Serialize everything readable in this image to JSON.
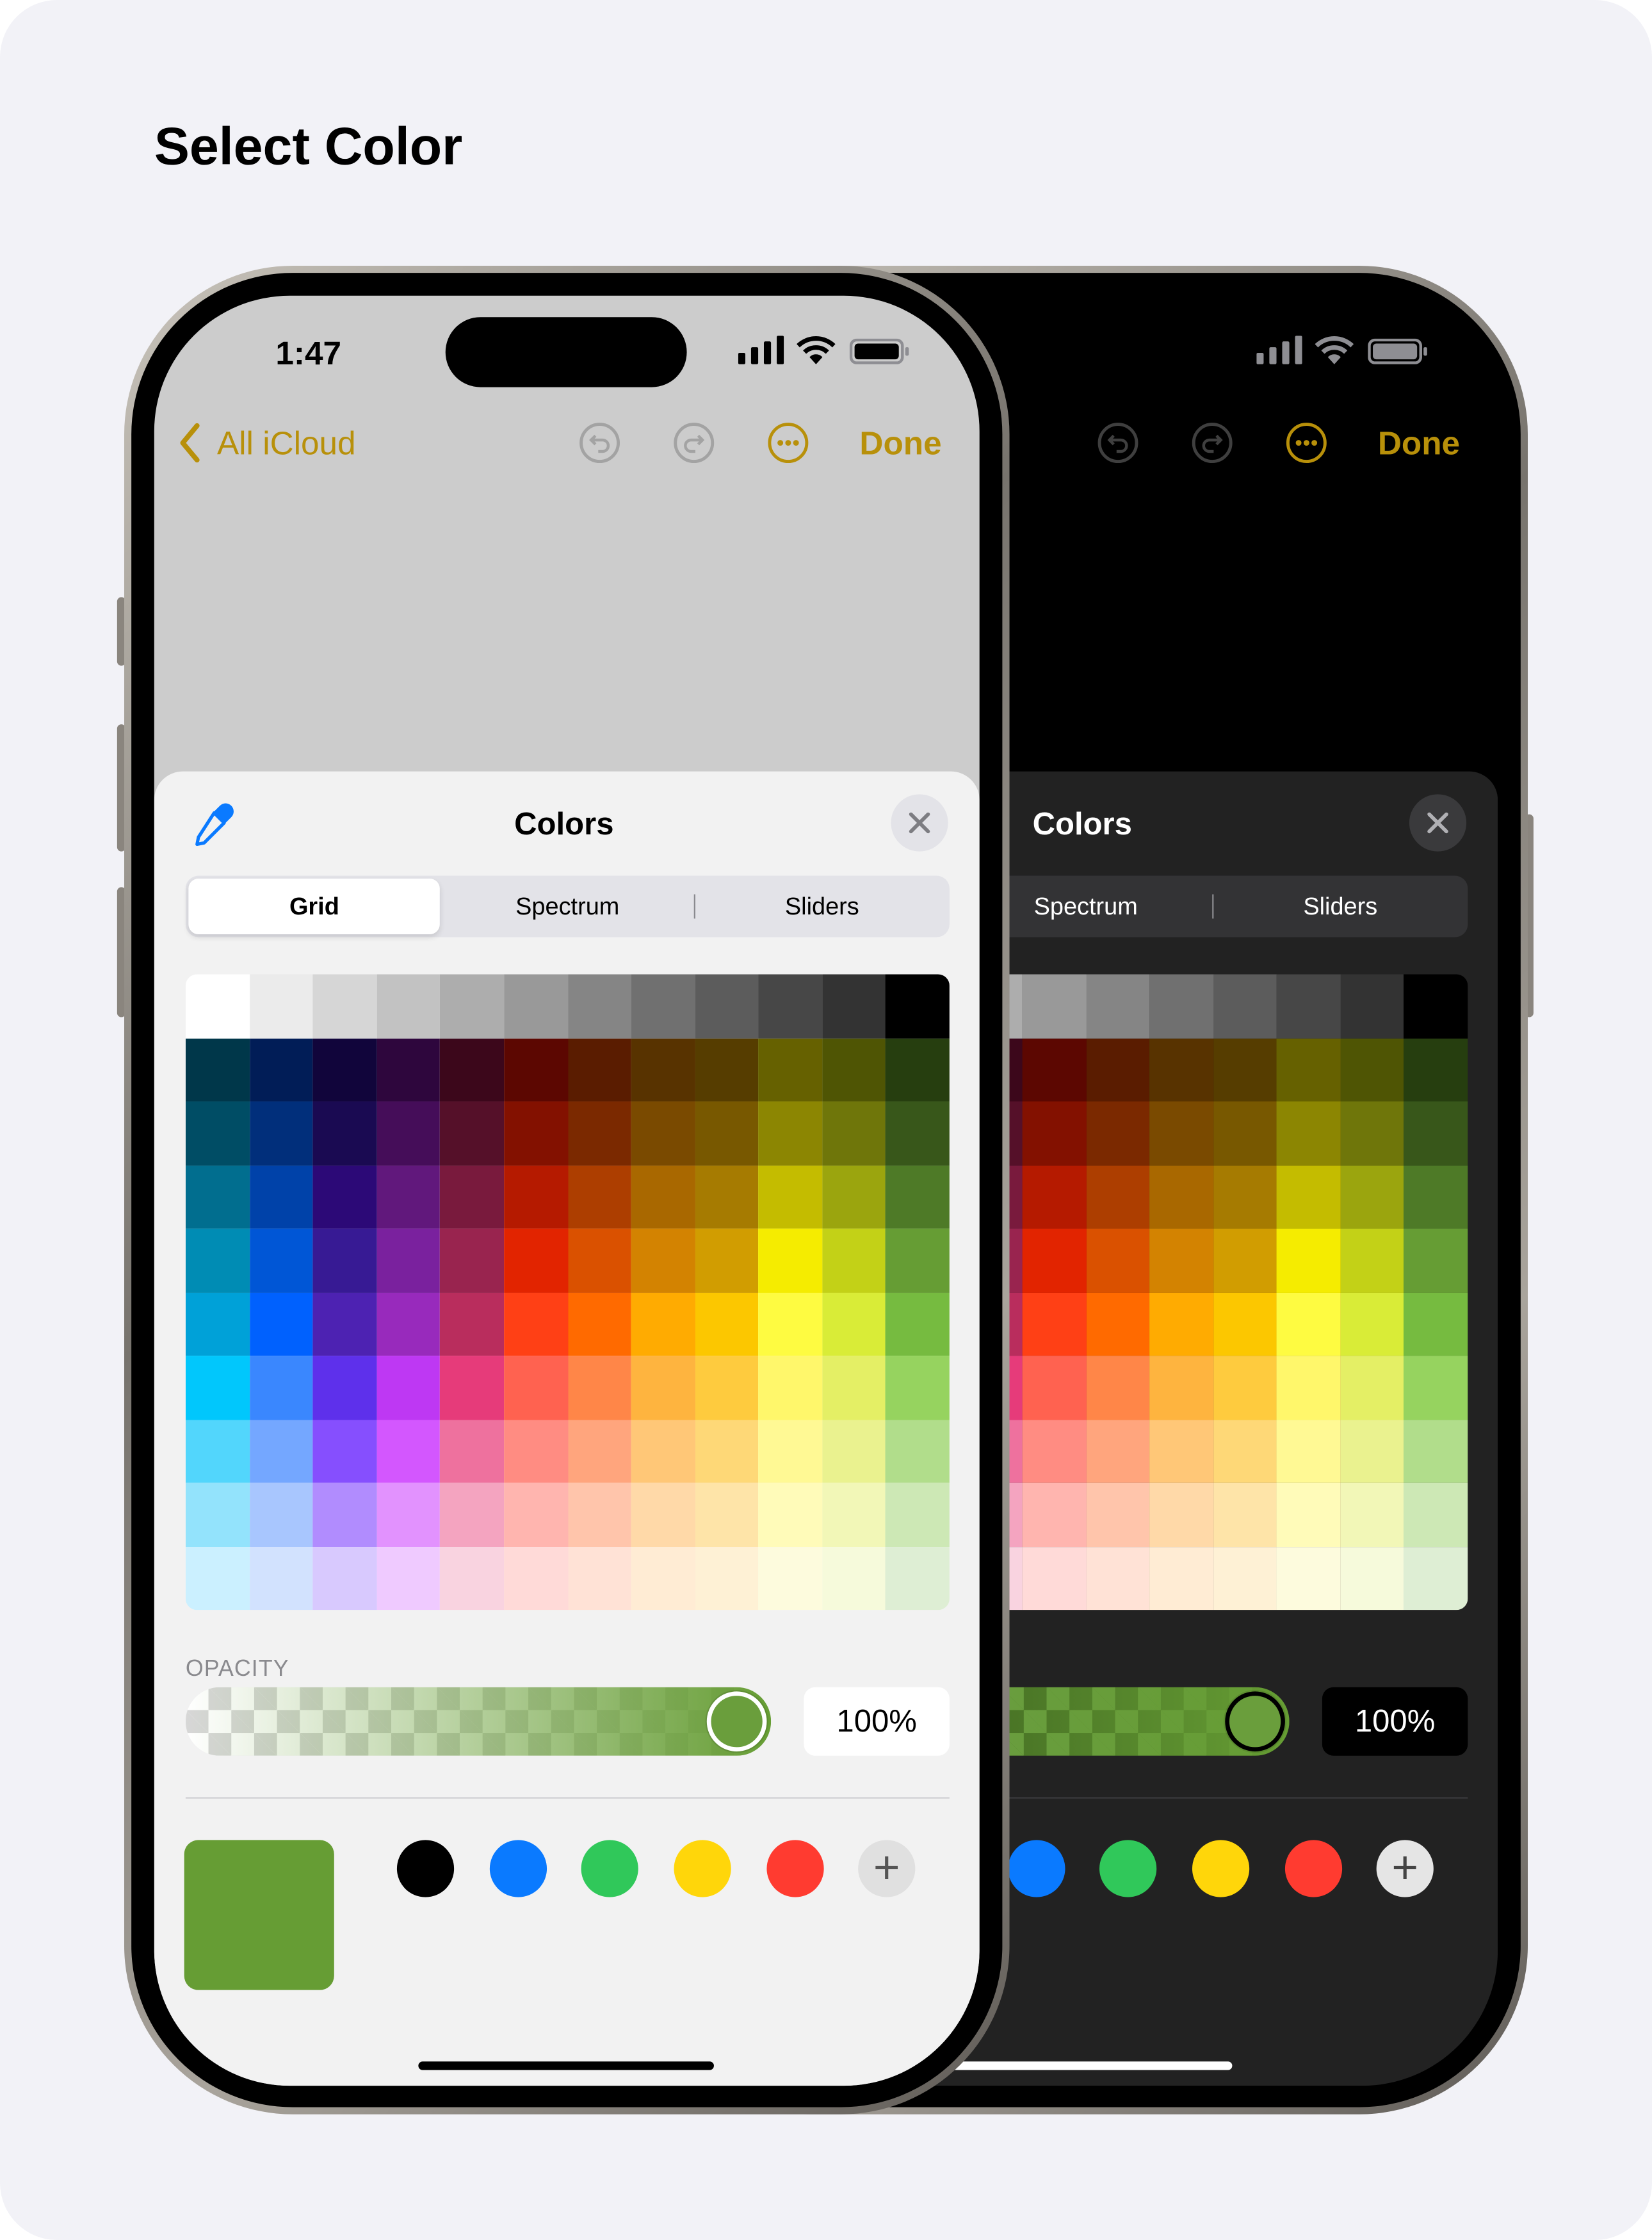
{
  "page_title": "Select Color",
  "status": {
    "time": "1:47"
  },
  "nav": {
    "back_label": "All iCloud",
    "done_label": "Done",
    "icons": [
      "undo-icon",
      "redo-icon",
      "more-icon"
    ]
  },
  "sheet": {
    "title": "Colors",
    "tabs": [
      {
        "label": "Grid",
        "selected": true
      },
      {
        "label": "Spectrum",
        "selected": false
      },
      {
        "label": "Sliders",
        "selected": false
      }
    ],
    "opacity_label": "OPACITY",
    "opacity_value": "100%",
    "opacity_percent": 100,
    "selected_color": "#669d34",
    "presets": [
      "#000000",
      "#0a7aff",
      "#30c85a",
      "#ffd60a",
      "#ff3b30"
    ],
    "add_label": "+"
  },
  "accent": "#b8900a",
  "grid": [
    [
      "#ffffff",
      "#ebebeb",
      "#d6d6d6",
      "#c2c2c2",
      "#adadad",
      "#999999",
      "#858585",
      "#707070",
      "#5c5c5c",
      "#474747",
      "#333333",
      "#000000"
    ],
    [
      "#00374a",
      "#011d57",
      "#11053b",
      "#2e063d",
      "#3c071b",
      "#5c0701",
      "#5a1c00",
      "#583300",
      "#563d00",
      "#666100",
      "#4f5504",
      "#263e0f"
    ],
    [
      "#004d65",
      "#012f7b",
      "#1a0a52",
      "#450d59",
      "#551029",
      "#831100",
      "#7b2900",
      "#7a4a00",
      "#785800",
      "#8c8602",
      "#6f760a",
      "#38571a"
    ],
    [
      "#016e8f",
      "#0042a9",
      "#2c0977",
      "#61187c",
      "#791a3d",
      "#b51a00",
      "#ad3e00",
      "#a96800",
      "#a67b01",
      "#c4bc00",
      "#9ba50e",
      "#4e7a27"
    ],
    [
      "#008cb4",
      "#0056d6",
      "#371a94",
      "#7a219e",
      "#99244f",
      "#e22400",
      "#da5100",
      "#d38301",
      "#d19d01",
      "#f5ec00",
      "#c3d117",
      "#669d34"
    ],
    [
      "#00a1d8",
      "#0061fe",
      "#4d22b2",
      "#982abc",
      "#b92d5d",
      "#ff4015",
      "#ff6a00",
      "#ffab01",
      "#fcc700",
      "#fefb41",
      "#d9ec37",
      "#76bb40"
    ],
    [
      "#01c7fc",
      "#3a87fe",
      "#5e30eb",
      "#be38f3",
      "#e63b7a",
      "#ff6250",
      "#ff8648",
      "#feb43f",
      "#fecb3e",
      "#fff76b",
      "#e4ef65",
      "#96d35f"
    ],
    [
      "#52d6fc",
      "#74a7ff",
      "#864ffe",
      "#d357fe",
      "#ee719e",
      "#ff8c82",
      "#ffa57d",
      "#ffc777",
      "#fed877",
      "#fff994",
      "#eaf28f",
      "#b1dd8b"
    ],
    [
      "#93e3fc",
      "#a8c6fe",
      "#b18cfe",
      "#e292fe",
      "#f4a4c0",
      "#ffb5af",
      "#ffc5ab",
      "#ffd9a8",
      "#fee4a8",
      "#fffbb9",
      "#f2f7b7",
      "#cde8b5"
    ],
    [
      "#cbf0ff",
      "#d2e2fe",
      "#d8c9fe",
      "#efcaff",
      "#f9d3e0",
      "#ffdad8",
      "#ffe2d6",
      "#ffecd4",
      "#fef1d5",
      "#fdfbdd",
      "#f6fadb",
      "#deeed4"
    ]
  ],
  "themes": {
    "light": {
      "top_bg": "#cccccc",
      "sheet_bg": "#f2f2f2",
      "text": "#000000",
      "seg_bg": "#e3e3e8",
      "seg_sel": "#ffffff",
      "field_bg": "#ffffff",
      "muted": "#8a8a8e",
      "icon_gray": "#a3a3a3",
      "close_bg": "#e3e3e8",
      "close_x": "#7d7d82",
      "add_bg": "#e0e0e0",
      "add_fg": "#555555",
      "divider": "#d0d0d4",
      "home": "#000000"
    },
    "dark": {
      "top_bg": "#000000",
      "sheet_bg": "#222222",
      "text": "#ffffff",
      "seg_bg": "#333335",
      "seg_sel": "#5a5a5e",
      "field_bg": "#000000",
      "muted": "#8a8a8e",
      "icon_gray": "#3f3f3f",
      "close_bg": "#3a3a3c",
      "close_x": "#b0b0b4",
      "add_bg": "#e5e5e5",
      "add_fg": "#444444",
      "divider": "#3a3a3c",
      "home": "#ffffff"
    }
  }
}
